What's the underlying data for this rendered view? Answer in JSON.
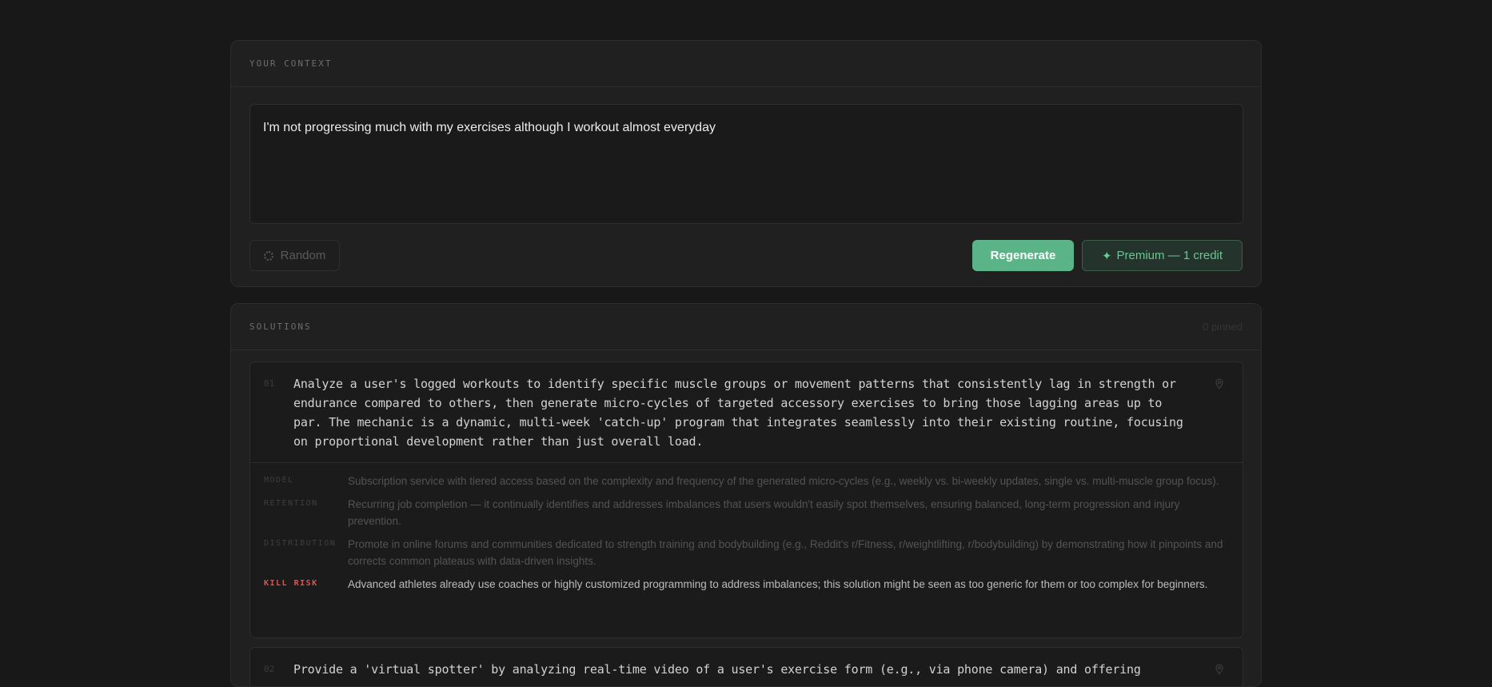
{
  "context": {
    "section_label": "YOUR CONTEXT",
    "input_text": "I'm not progressing much with my exercises although I workout almost everyday",
    "random_label": "Random",
    "regenerate_label": "Regenerate",
    "premium_star": "✦",
    "premium_label": "Premium — 1 credit"
  },
  "solutions": {
    "section_label": "SOLUTIONS",
    "pinned_text": "0 pinned",
    "items": [
      {
        "number": "01",
        "text": "Analyze a user's logged workouts to identify specific muscle groups or movement patterns that consistently lag in strength or endurance compared to others, then generate micro-cycles of targeted accessory exercises to bring those lagging areas up to par. The mechanic is a dynamic, multi-week 'catch-up' program that integrates seamlessly into their existing routine, focusing on proportional development rather than just overall load.",
        "model_label": "MODEL",
        "model": "Subscription service with tiered access based on the complexity and frequency of the generated micro-cycles (e.g., weekly vs. bi-weekly updates, single vs. multi-muscle group focus).",
        "retention_label": "RETENTION",
        "retention": "Recurring job completion — it continually identifies and addresses imbalances that users wouldn't easily spot themselves, ensuring balanced, long-term progression and injury prevention.",
        "distribution_label": "DISTRIBUTION",
        "distribution": "Promote in online forums and communities dedicated to strength training and bodybuilding (e.g., Reddit's r/Fitness, r/weightlifting, r/bodybuilding) by demonstrating how it pinpoints and corrects common plateaus with data-driven insights.",
        "kill_risk_label": "KILL RISK",
        "kill_risk": "Advanced athletes already use coaches or highly customized programming to address imbalances; this solution might be seen as too generic for them or too complex for beginners."
      },
      {
        "number": "02",
        "text": "Provide a 'virtual spotter' by analyzing real-time video of a user's exercise form (e.g., via phone camera) and offering"
      }
    ]
  },
  "colors": {
    "background": "#181818",
    "panel": "#202020",
    "accent": "#5bb488",
    "danger": "#e0524d"
  }
}
